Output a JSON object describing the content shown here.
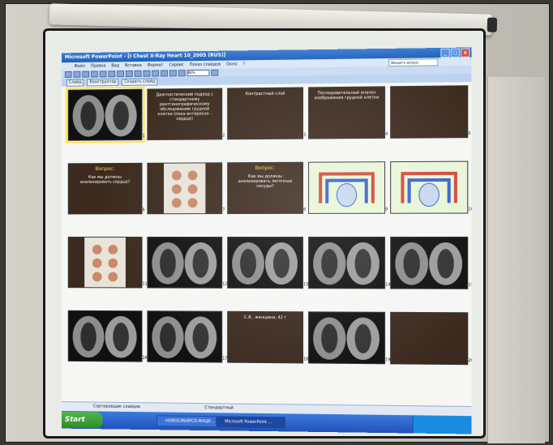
{
  "window": {
    "title": "Microsoft PowerPoint - [I Chest X-Ray Heart 10_2005 (RUS)]",
    "controls": [
      "_",
      "□",
      "x"
    ]
  },
  "menu": {
    "items": [
      "Файл",
      "Правка",
      "Вид",
      "Вставка",
      "Формат",
      "Сервис",
      "Показ слайдов",
      "Окно",
      "?"
    ],
    "help_placeholder": "Введите вопрос"
  },
  "toolbar": {
    "zoom": "66%",
    "buttons": [
      "Слайд",
      "Конструктор",
      "Создать слайд"
    ]
  },
  "slides": [
    {
      "num": "1",
      "kind": "xray"
    },
    {
      "num": "2",
      "kind": "text",
      "text": "Диагностический подход с стандартному рентгенографическому обследованию грудной клетки (пока интересно - сердце)"
    },
    {
      "num": "3",
      "kind": "text",
      "text": "Контрастный слой"
    },
    {
      "num": "4",
      "kind": "text",
      "text": "Последовательный анализ изображения грудной клетки"
    },
    {
      "num": "5",
      "kind": "text",
      "text": ""
    },
    {
      "num": "6",
      "kind": "question",
      "heading": "Вопрос:",
      "text": "Как мы должны анализировать сердце?"
    },
    {
      "num": "7",
      "kind": "hearts"
    },
    {
      "num": "8",
      "kind": "question",
      "heading": "Вопрос:",
      "text": "Как мы должны анализировать легочные сосуды?"
    },
    {
      "num": "9",
      "kind": "diagram"
    },
    {
      "num": "10",
      "kind": "diagram"
    },
    {
      "num": "11",
      "kind": "hearts"
    },
    {
      "num": "12",
      "kind": "xray"
    },
    {
      "num": "13",
      "kind": "xray"
    },
    {
      "num": "14",
      "kind": "xray"
    },
    {
      "num": "15",
      "kind": "xray"
    },
    {
      "num": "16",
      "kind": "ct"
    },
    {
      "num": "17",
      "kind": "xray"
    },
    {
      "num": "18",
      "kind": "text",
      "text": "С.Я., женщина, 42 г"
    },
    {
      "num": "19",
      "kind": "xray"
    },
    {
      "num": "20",
      "kind": "text",
      "text": ""
    }
  ],
  "status": {
    "left": "Сортировщик слайдов",
    "center": "Стандартный"
  },
  "taskbar": {
    "start": "Start",
    "tasks": [
      "НОВОСИБИРСК-ВНЦИ...",
      "Microsoft PowerPoint ..."
    ]
  },
  "colors": {
    "title_bar": "#2360b8",
    "slide_bg": "#3c2a1e",
    "selection": "#ffe24a"
  }
}
